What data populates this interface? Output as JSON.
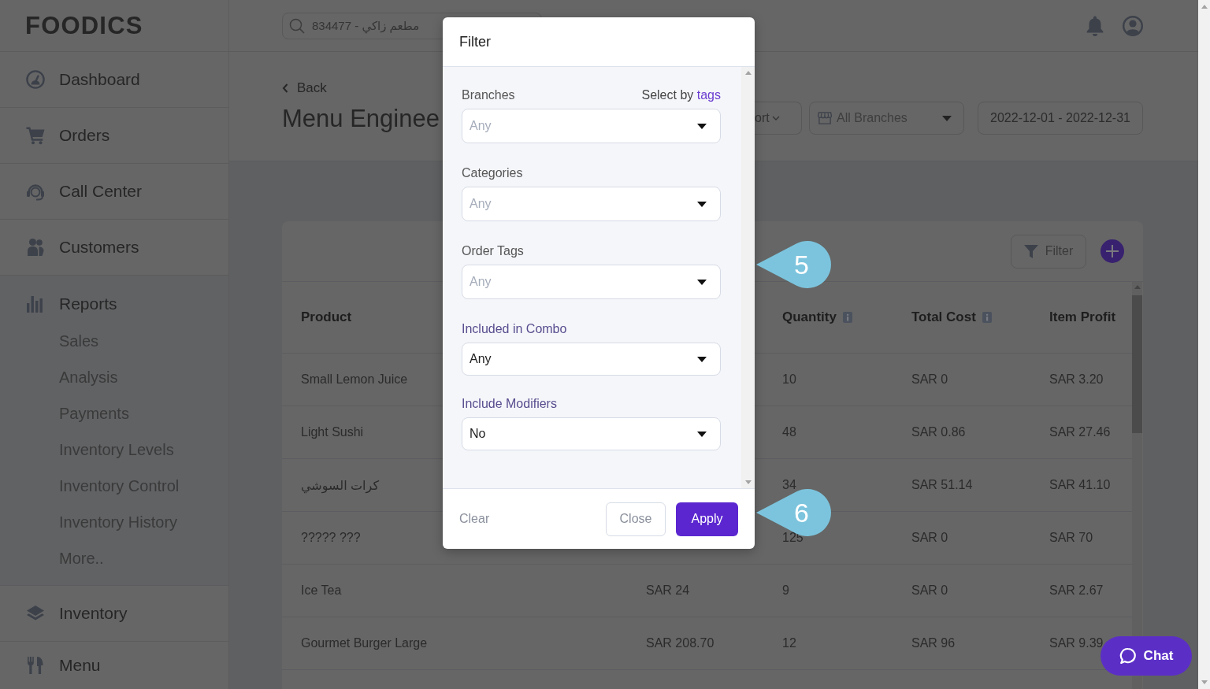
{
  "sidebar": {
    "logo": "FOODICS",
    "items": [
      {
        "label": "Dashboard",
        "expanded": false
      },
      {
        "label": "Orders",
        "expanded": false
      },
      {
        "label": "Call Center",
        "expanded": false
      },
      {
        "label": "Customers",
        "expanded": false
      },
      {
        "label": "Reports",
        "expanded": true,
        "children": [
          {
            "label": "Sales"
          },
          {
            "label": "Analysis"
          },
          {
            "label": "Payments"
          },
          {
            "label": "Inventory Levels"
          },
          {
            "label": "Inventory Control"
          },
          {
            "label": "Inventory History"
          },
          {
            "label": "More.."
          }
        ]
      },
      {
        "label": "Inventory",
        "expanded": false
      },
      {
        "label": "Menu",
        "expanded": false
      }
    ]
  },
  "top_bar": {
    "search": {
      "value": "834477 - مطعم زاكي"
    }
  },
  "page_header": {
    "back": "Back",
    "title": "Menu Enginee",
    "export_button": "ort",
    "branches": {
      "value": "All Branches"
    },
    "date_range": "2022-12-01 - 2022-12-31"
  },
  "report_card": {
    "filter_button": "Filter",
    "table": {
      "columns": [
        {
          "label": "Product",
          "info": false
        },
        null,
        {
          "label": "Quantity",
          "info": true
        },
        {
          "label": "Total Cost",
          "info": true
        },
        {
          "label": "Item Profit",
          "info": false
        }
      ],
      "rows": [
        [
          "Small Lemon Juice",
          null,
          "10",
          "SAR 0",
          "SAR 3.20"
        ],
        [
          "Light Sushi",
          null,
          "48",
          "SAR 0.86",
          "SAR 27.46"
        ],
        [
          "كرات السوشي",
          null,
          "34",
          "SAR 51.14",
          "SAR 41.10"
        ],
        [
          "????? ???",
          null,
          "125",
          "SAR 0",
          "SAR 70"
        ],
        [
          "Ice Tea",
          "SAR 24",
          "9",
          "SAR 0",
          "SAR 2.67"
        ],
        [
          "Gourmet Burger Large",
          "SAR 208.70",
          "12",
          "SAR 96",
          "SAR 9.39"
        ]
      ]
    }
  },
  "filter_dialog": {
    "title": "Filter",
    "fields": [
      {
        "label": "Branches",
        "kind": "multiselect",
        "placeholder": "Any",
        "aside": {
          "text": "Select by",
          "link": "tags"
        }
      },
      {
        "label": "Categories",
        "kind": "multiselect",
        "placeholder": "Any"
      },
      {
        "label": "Order Tags",
        "kind": "multiselect",
        "placeholder": "Any"
      },
      {
        "label": "Included in Combo",
        "kind": "select",
        "value": "Any"
      },
      {
        "label": "Include Modifiers",
        "kind": "select",
        "value": "No"
      }
    ],
    "clear": "Clear",
    "buttons": [
      {
        "label": "Close",
        "kind": "secondary"
      },
      {
        "label": "Apply",
        "kind": "primary"
      }
    ]
  },
  "callouts": [
    {
      "label": "5"
    },
    {
      "label": "6"
    }
  ],
  "chat_button": {
    "label": "Chat"
  }
}
